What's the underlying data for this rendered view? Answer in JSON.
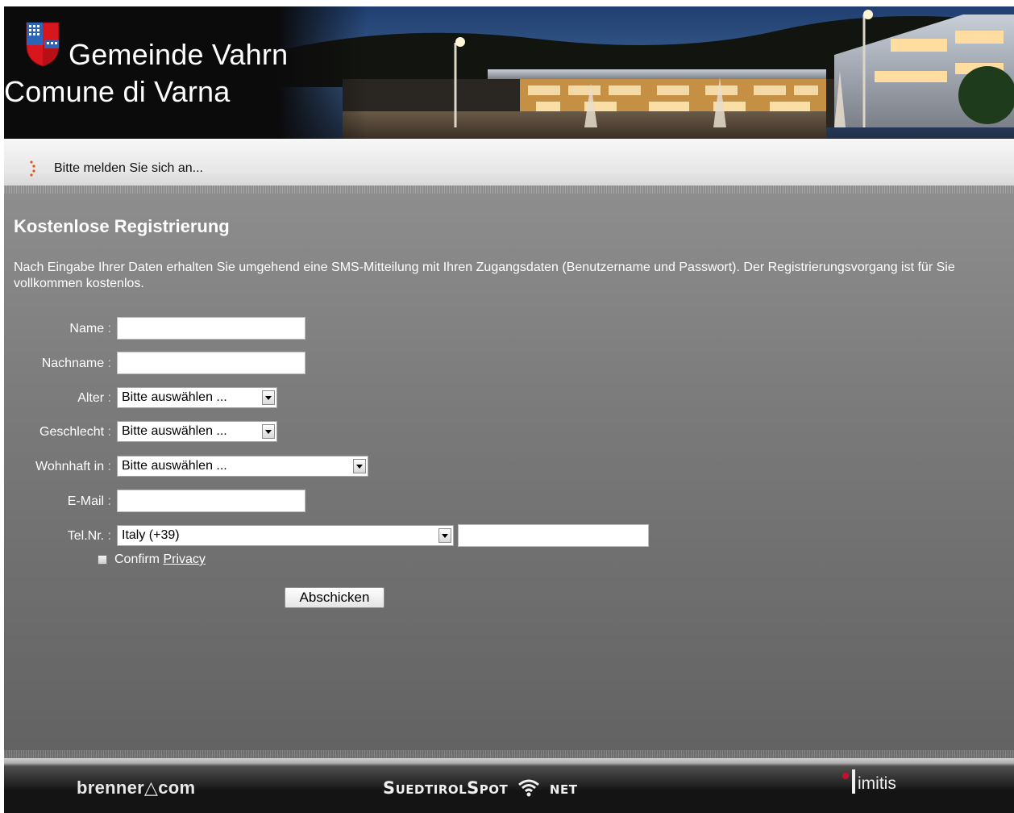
{
  "header": {
    "title_de": "Gemeinde Vahrn",
    "title_it": "Comune di Varna",
    "crest_icon": "municipal-coat-of-arms",
    "banner": "municipal-building-at-dusk"
  },
  "loginbar": {
    "message": "Bitte melden Sie sich an...",
    "marker_icon": "dotted-arrow-icon",
    "marker_color": "#e2531c"
  },
  "form": {
    "heading": "Kostenlose Registrierung",
    "intro": "Nach Eingabe Ihrer Daten erhalten Sie umgehend eine SMS-Mitteilung mit Ihren Zugangsdaten (Benutzername und Passwort). Der Registrierungsvorgang ist für Sie vollkommen kostenlos.",
    "fields": {
      "name": {
        "label": "Name",
        "value": ""
      },
      "nachname": {
        "label": "Nachname",
        "value": ""
      },
      "alter": {
        "label": "Alter",
        "selected": "Bitte auswählen ..."
      },
      "geschlecht": {
        "label": "Geschlecht",
        "selected": "Bitte auswählen ..."
      },
      "wohnhaft": {
        "label": "Wohnhaft in",
        "selected": "Bitte auswählen ..."
      },
      "email": {
        "label": "E-Mail",
        "value": ""
      },
      "tel": {
        "label": "Tel.Nr.",
        "country_selected": "Italy (+39)",
        "number": ""
      }
    },
    "colon": ":",
    "confirm_label": "Confirm",
    "privacy_link": "Privacy",
    "submit_label": "Abschicken"
  },
  "footer": {
    "brenner_text": "brenner",
    "brenner_delta": "△",
    "brenner_suffix": "com",
    "sued_text_a": "SuedtirolSpot",
    "sued_text_b": "net",
    "limitis_text": "imitis",
    "limitis_dot_color": "#c8102e"
  },
  "colors": {
    "panel_top": "#8e8e8e",
    "panel_bottom": "#626262",
    "header_bg": "#0b0b0c"
  }
}
